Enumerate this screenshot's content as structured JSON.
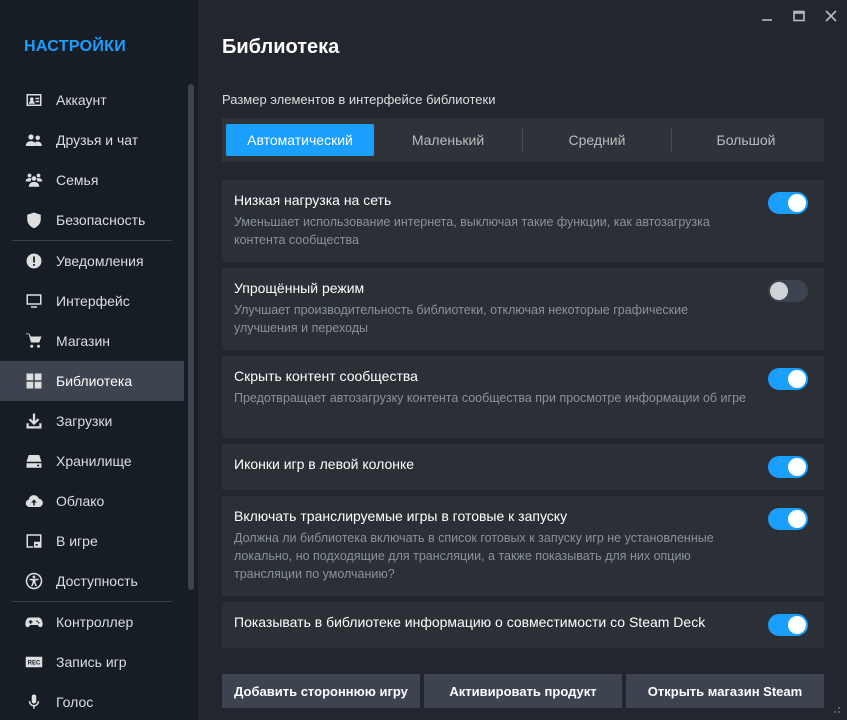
{
  "sidebar": {
    "title": "НАСТРОЙКИ",
    "items": [
      {
        "label": "Аккаунт",
        "icon": "account-card-icon"
      },
      {
        "label": "Друзья и чат",
        "icon": "friends-icon"
      },
      {
        "label": "Семья",
        "icon": "family-icon"
      },
      {
        "label": "Безопасность",
        "icon": "shield-icon"
      },
      {
        "label": "Уведомления",
        "icon": "alert-icon"
      },
      {
        "label": "Интерфейс",
        "icon": "monitor-icon"
      },
      {
        "label": "Магазин",
        "icon": "cart-icon"
      },
      {
        "label": "Библиотека",
        "icon": "grid-icon",
        "active": true
      },
      {
        "label": "Загрузки",
        "icon": "download-icon"
      },
      {
        "label": "Хранилище",
        "icon": "drive-icon"
      },
      {
        "label": "Облако",
        "icon": "cloud-icon"
      },
      {
        "label": "В игре",
        "icon": "ingame-icon"
      },
      {
        "label": "Доступность",
        "icon": "accessibility-icon"
      },
      {
        "label": "Контроллер",
        "icon": "gamepad-icon"
      },
      {
        "label": "Запись игр",
        "icon": "rec-icon"
      },
      {
        "label": "Голос",
        "icon": "microphone-icon"
      }
    ]
  },
  "main": {
    "title": "Библиотека",
    "size_label": "Размер элементов в интерфейсе библиотеки",
    "size_options": [
      "Автоматический",
      "Маленький",
      "Средний",
      "Большой"
    ],
    "size_selected": "Автоматический",
    "settings": [
      {
        "title": "Низкая нагрузка на сеть",
        "desc": "Уменьшает использование интернета, выключая такие функции, как автозагрузка контента сообщества",
        "on": true
      },
      {
        "title": "Упрощённый режим",
        "desc": "Улучшает производительность библиотеки, отключая некоторые графические улучшения и переходы",
        "on": false
      },
      {
        "title": "Скрыть контент сообщества",
        "desc": "Предотвращает автозагрузку контента сообщества при просмотре информации об игре",
        "on": true
      },
      {
        "title": "Иконки игр в левой колонке",
        "desc": "",
        "on": true
      },
      {
        "title": "Включать транслируемые игры в готовые к запуску",
        "desc": "Должна ли библиотека включать в список готовых к запуску игр не установленные локально, но подходящие для трансляции, а также показывать для них опцию трансляции по умолчанию?",
        "on": true
      },
      {
        "title": "Показывать в библиотеке информацию о совместимости со Steam Deck",
        "desc": "",
        "on": true
      }
    ],
    "footer_buttons": [
      "Добавить стороннюю игру",
      "Активировать продукт",
      "Открыть магазин Steam"
    ]
  },
  "colors": {
    "accent": "#1a9fff",
    "sidebar_bg": "#171d25",
    "main_bg": "#23262e",
    "card_bg": "#2b2f36"
  }
}
